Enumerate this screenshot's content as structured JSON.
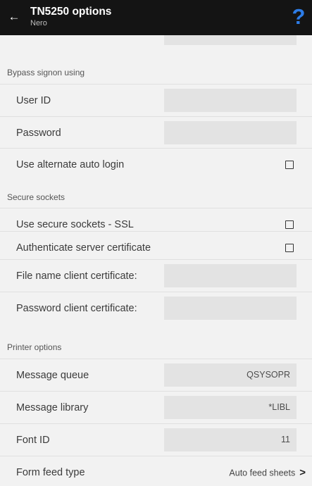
{
  "header": {
    "title": "TN5250 options",
    "subtitle": "Nero",
    "back_icon": "←",
    "help_icon": "?"
  },
  "sections": {
    "bypass": {
      "title": "Bypass signon using",
      "user_id": {
        "label": "User ID",
        "value": ""
      },
      "password": {
        "label": "Password",
        "value": ""
      },
      "alt_login": {
        "label": "Use alternate auto login",
        "checked": false
      }
    },
    "secure": {
      "title": "Secure sockets",
      "ssl": {
        "label": "Use secure sockets - SSL",
        "checked": false
      },
      "auth_cert": {
        "label": "Authenticate server certificate",
        "checked": false
      },
      "client_cert_file": {
        "label": "File name client certificate:",
        "value": ""
      },
      "client_cert_password": {
        "label": "Password client certificate:",
        "value": ""
      }
    },
    "printer": {
      "title": "Printer options",
      "message_queue": {
        "label": "Message queue",
        "value": "QSYSOPR"
      },
      "message_library": {
        "label": "Message library",
        "value": "*LIBL"
      },
      "font_id": {
        "label": "Font ID",
        "value": "11"
      },
      "form_feed": {
        "label": "Form feed type",
        "value": "Auto feed sheets",
        "chevron": ">"
      }
    }
  }
}
